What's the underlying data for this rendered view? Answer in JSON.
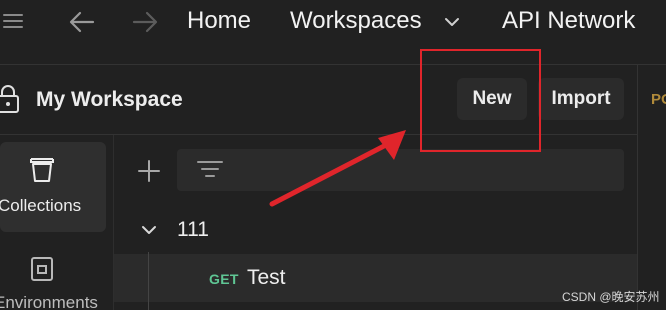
{
  "topbar": {
    "menu_icon": "hamburger-icon",
    "back_icon": "arrow-left-icon",
    "forward_icon": "arrow-right-icon",
    "home_label": "Home",
    "workspaces_label": "Workspaces",
    "api_network_label": "API Network"
  },
  "workspace": {
    "title": "My Workspace",
    "lock_icon": "lock-icon",
    "new_label": "New",
    "import_label": "Import",
    "right_tab_text": "PO"
  },
  "sidebar": {
    "items": [
      {
        "label": "Collections",
        "icon": "collections-icon",
        "active": true
      },
      {
        "label": "Environments",
        "icon": "environments-icon",
        "active": false
      }
    ]
  },
  "collections": {
    "add_icon": "plus-icon",
    "filter_icon": "filter-icon",
    "tree": [
      {
        "name": "111",
        "expanded": true,
        "children": [
          {
            "method": "GET",
            "name": "Test"
          }
        ]
      }
    ]
  },
  "colors": {
    "background": "#212121",
    "panel": "#2b2b2b",
    "get_method": "#5fc694",
    "annotation": "#e0252b"
  },
  "watermark": "CSDN @晚安苏州"
}
